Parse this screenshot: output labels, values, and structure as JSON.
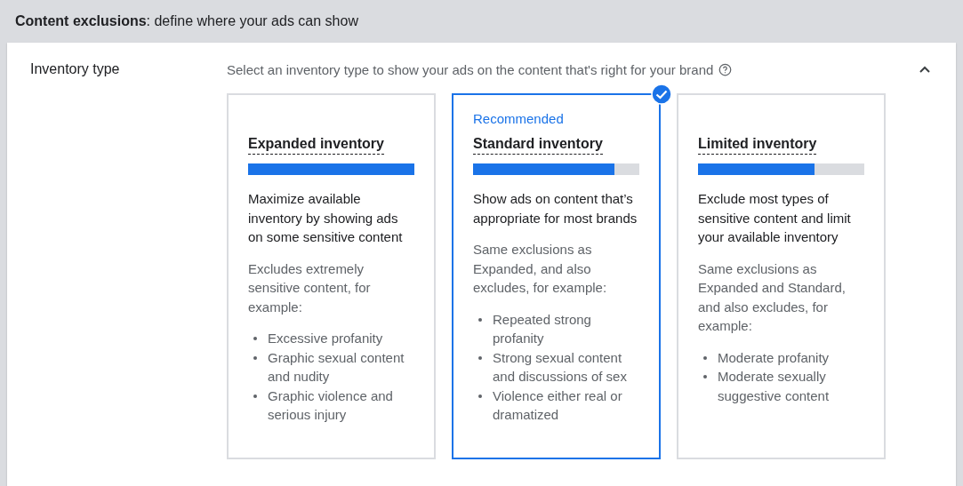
{
  "header": {
    "title": "**Content exclusions**: define where your ads can show"
  },
  "section": {
    "label": "Inventory type",
    "description": "Select an inventory type to show your ads on the content that's right for your brand",
    "expanded": true
  },
  "options": [
    {
      "title": "Expanded inventory",
      "selected": false,
      "level": 1.0,
      "summary": "Maximize available inventory by showing ads on some sensitive content",
      "details": "Excludes extremely sensitive content, for example:",
      "examples": [
        "Excessive profanity",
        "Graphic sexual content and nudity",
        "Graphic violence and serious injury"
      ]
    },
    {
      "title": "Standard inventory",
      "badge": "Recommended",
      "selected": true,
      "level": 0.85,
      "summary": "Show ads on content that’s appropriate for most brands",
      "details": "Same exclusions as Expanded, and also excludes, for example:",
      "examples": [
        "Repeated strong profanity",
        "Strong sexual content and discussions of sex",
        "Violence either real or dramatized"
      ]
    },
    {
      "title": "Limited inventory",
      "selected": false,
      "level": 0.7,
      "summary": "Exclude most types of sensitive content and limit your available inventory",
      "details": "Same exclusions as Expanded and Standard, and also excludes, for example:",
      "examples": [
        "Moderate profanity",
        "Moderate sexually suggestive content"
      ]
    }
  ]
}
